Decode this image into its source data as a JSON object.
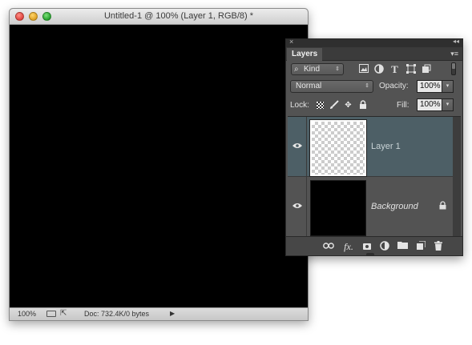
{
  "document": {
    "title": "Untitled-1 @ 100% (Layer 1, RGB/8) *",
    "status": {
      "zoom": "100%",
      "doc_info": "Doc: 732.4K/0 bytes",
      "arrow": "▶"
    }
  },
  "panel": {
    "strip_close": "×",
    "strip_collapse": "◂◂",
    "tab_label": "Layers",
    "menu_icon": "▾≡",
    "filter": {
      "kind_label": "Kind",
      "kind_icon": "⌕",
      "arrows": "⇕",
      "icons": [
        "image-filter-icon",
        "adjustment-filter-icon",
        "type-filter-icon",
        "shape-filter-icon",
        "smart-object-filter-icon"
      ],
      "type_glyph": "T"
    },
    "blend_mode": "Normal",
    "opacity_label": "Opacity:",
    "opacity_value": "100%",
    "lock_label": "Lock:",
    "fill_label": "Fill:",
    "fill_value": "100%",
    "layers": [
      {
        "name": "Layer 1",
        "selected": true,
        "visible": true,
        "thumb": "transparent"
      },
      {
        "name": "Background",
        "selected": false,
        "visible": true,
        "thumb": "black",
        "locked": true
      }
    ],
    "footer_icons": [
      "link-layers-icon",
      "fx-icon",
      "add-mask-icon",
      "adjustment-layer-icon",
      "new-group-icon",
      "new-layer-icon",
      "trash-icon"
    ],
    "fx_text": "fx."
  },
  "colors": {
    "panel_bg": "#535353",
    "selected_row": "#4d5f66",
    "canvas": "#000000"
  }
}
